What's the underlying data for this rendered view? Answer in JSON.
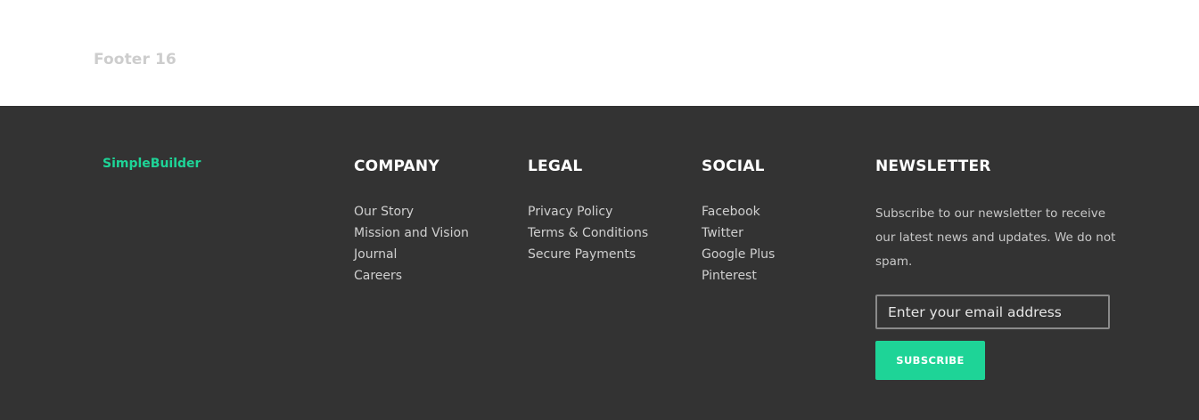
{
  "page": {
    "label": "Footer 16"
  },
  "footer": {
    "brand": "SimpleBuilder",
    "company": {
      "heading": "COMPANY",
      "links": [
        "Our Story",
        "Mission and Vision",
        "Journal",
        "Careers"
      ]
    },
    "legal": {
      "heading": "LEGAL",
      "links": [
        "Privacy Policy",
        "Terms & Conditions",
        "Secure Payments"
      ]
    },
    "social": {
      "heading": "SOCIAL",
      "links": [
        "Facebook",
        "Twitter",
        "Google Plus",
        "Pinterest"
      ]
    },
    "newsletter": {
      "heading": "NEWSLETTER",
      "description": "Subscribe to our newsletter to receive our latest news and updates. We do not spam.",
      "email_placeholder": "Enter your email address",
      "email_value": "",
      "subscribe_label": "SUBSCRIBE"
    }
  },
  "colors": {
    "accent": "#1ed497",
    "footer_background": "#333333",
    "page_background": "#ffffff",
    "label_gray": "#cdcdcd"
  }
}
